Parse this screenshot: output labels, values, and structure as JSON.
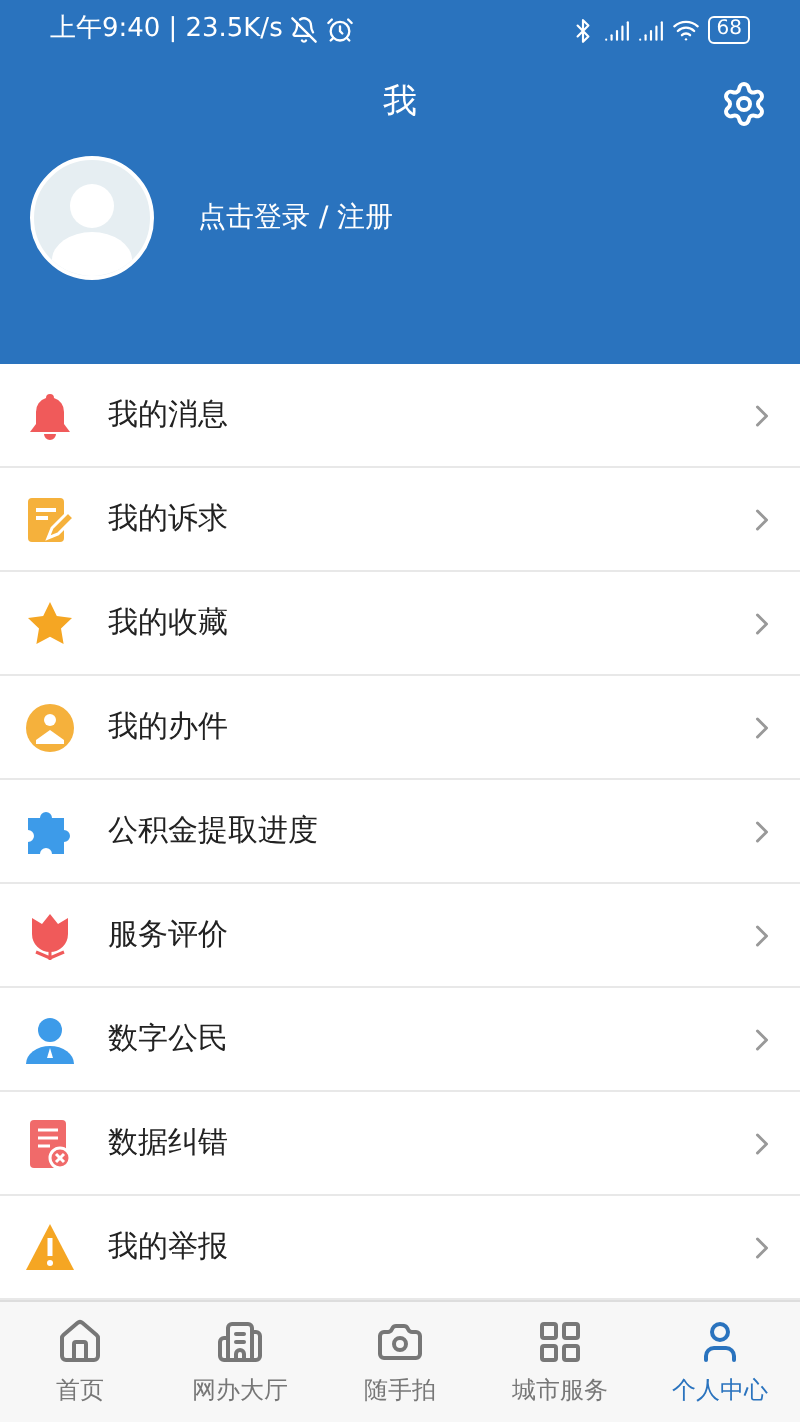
{
  "status_bar": {
    "time": "上午9:40",
    "speed": "| 23.5K/s",
    "battery": "68"
  },
  "header": {
    "title": "我"
  },
  "profile": {
    "login_text": "点击登录 / 注册"
  },
  "menu": [
    {
      "label": "我的消息"
    },
    {
      "label": "我的诉求"
    },
    {
      "label": "我的收藏"
    },
    {
      "label": "我的办件"
    },
    {
      "label": "公积金提取进度"
    },
    {
      "label": "服务评价"
    },
    {
      "label": "数字公民"
    },
    {
      "label": "数据纠错"
    },
    {
      "label": "我的举报"
    }
  ],
  "tab_bar": [
    {
      "label": "首页",
      "selected": false
    },
    {
      "label": "网办大厅",
      "selected": false
    },
    {
      "label": "随手拍",
      "selected": false
    },
    {
      "label": "城市服务",
      "selected": false
    },
    {
      "label": "个人中心",
      "selected": true
    }
  ]
}
